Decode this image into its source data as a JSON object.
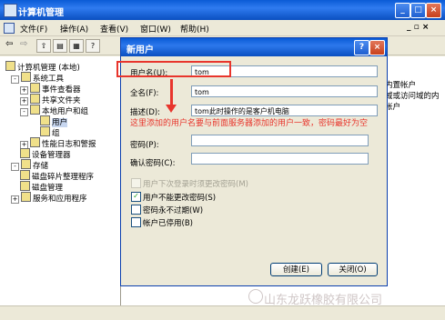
{
  "main_window": {
    "title": "计算机管理",
    "menu": [
      "文件(F)",
      "操作(A)",
      "查看(V)",
      "窗口(W)",
      "帮助(H)"
    ],
    "mdi_controls": "_ ▫ ×",
    "caption_min": "_",
    "caption_max": "□",
    "caption_close": "×"
  },
  "tree": [
    {
      "label": "计算机管理 (本地)",
      "indent": 0,
      "expander": ""
    },
    {
      "label": "系统工具",
      "indent": 1,
      "expander": "-"
    },
    {
      "label": "事件查看器",
      "indent": 2,
      "expander": "+"
    },
    {
      "label": "共享文件夹",
      "indent": 2,
      "expander": "+"
    },
    {
      "label": "本地用户和组",
      "indent": 2,
      "expander": "-"
    },
    {
      "label": "用户",
      "indent": 3,
      "expander": ""
    },
    {
      "label": "组",
      "indent": 3,
      "expander": ""
    },
    {
      "label": "性能日志和警报",
      "indent": 2,
      "expander": "+"
    },
    {
      "label": "设备管理器",
      "indent": 2,
      "expander": ""
    },
    {
      "label": "存储",
      "indent": 1,
      "expander": "-"
    },
    {
      "label": "磁盘碎片整理程序",
      "indent": 2,
      "expander": ""
    },
    {
      "label": "磁盘管理",
      "indent": 2,
      "expander": ""
    },
    {
      "label": "服务和应用程序",
      "indent": 1,
      "expander": "+"
    }
  ],
  "right_pane_text": [
    "内置帐户",
    "域或访问域的内",
    "帐户"
  ],
  "dialog": {
    "title": "新用户",
    "help_btn": "?",
    "close_btn": "×",
    "username_label": "用户名(U):",
    "username_value": "tom",
    "fullname_label": "全名(F):",
    "fullname_value": "tom",
    "desc_label": "描述(D):",
    "desc_value": "tom此时操作的是客户机电脑",
    "password_label": "密码(P):",
    "confirm_label": "确认密码(C):",
    "checkboxes": [
      {
        "label": "用户下次登录时须更改密码(M)",
        "checked": false,
        "disabled": true
      },
      {
        "label": "用户不能更改密码(S)",
        "checked": true,
        "disabled": false
      },
      {
        "label": "密码永不过期(W)",
        "checked": false,
        "disabled": false
      },
      {
        "label": "帐户已停用(B)",
        "checked": false,
        "disabled": false
      }
    ],
    "create_btn": "创建(E)",
    "close_label": "关闭(O)"
  },
  "annotation": "这里添加的用户名要与前面服务器添加的用户一致，密码最好为空",
  "watermark": "山东龙跃橡胶有限公司",
  "colors": {
    "accent_red": "#e8352c",
    "titlebar_blue": "#0a5bd6"
  }
}
